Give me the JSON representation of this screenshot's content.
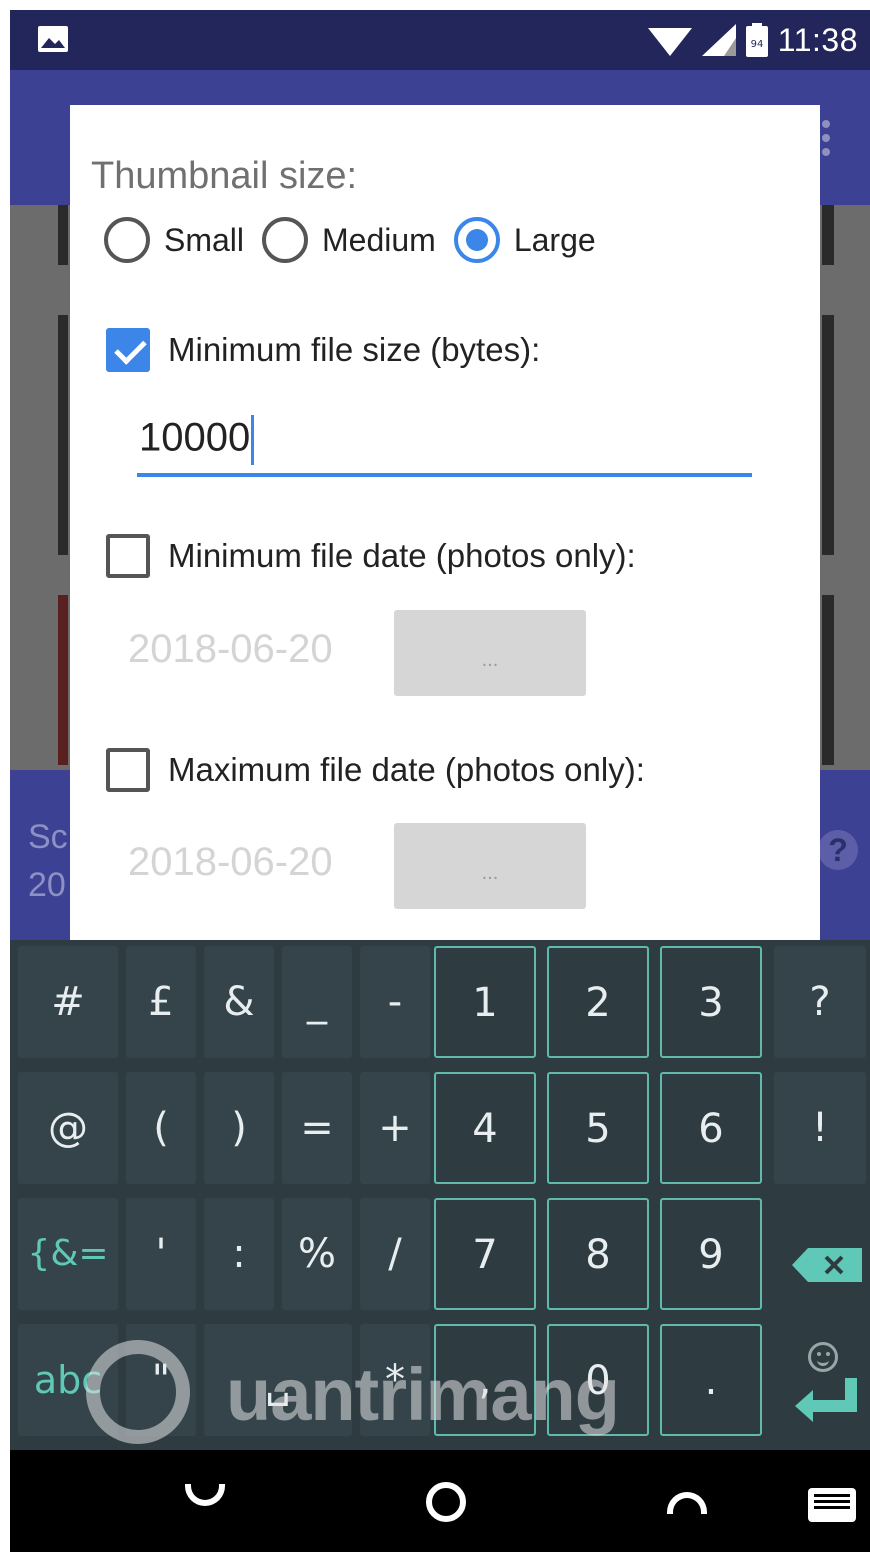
{
  "status_bar": {
    "time": "11:38",
    "battery_level": "94",
    "icons": [
      "gallery-notification-icon",
      "wifi-icon",
      "cell-signal-icon",
      "battery-icon"
    ]
  },
  "background_app": {
    "bottom_text_line1": "Sc",
    "bottom_text_line2": "20",
    "help_label": "?"
  },
  "dialog": {
    "title": "Thumbnail size:",
    "thumbnail_options": [
      {
        "label": "Small",
        "selected": false
      },
      {
        "label": "Medium",
        "selected": false
      },
      {
        "label": "Large",
        "selected": true
      }
    ],
    "min_file_size": {
      "label": "Minimum file size (bytes):",
      "checked": true,
      "value": "10000"
    },
    "min_file_date": {
      "label": "Minimum file date (photos only):",
      "checked": false,
      "date": "2018-06-20",
      "button_label": "..."
    },
    "max_file_date": {
      "label": "Maximum file date (photos only):",
      "checked": false,
      "date": "2018-06-20",
      "button_label": "..."
    }
  },
  "keyboard": {
    "row1": [
      "#",
      "£",
      "&",
      "_",
      "-",
      "1",
      "2",
      "3",
      "?"
    ],
    "row2": [
      "@",
      "(",
      ")",
      "=",
      "+",
      "4",
      "5",
      "6",
      "!"
    ],
    "row3": [
      "{&=",
      "'",
      ":",
      "%",
      "/",
      "7",
      "8",
      "9"
    ],
    "row4": [
      "abc",
      "\"",
      "␣",
      "*",
      ",",
      "0",
      "."
    ],
    "accent_color": "#5fc8b6"
  },
  "watermark": {
    "text": "uantrimang"
  },
  "navigation": {
    "icons": [
      "back-icon",
      "home-icon",
      "recents-icon",
      "keyboard-switch-icon"
    ]
  }
}
